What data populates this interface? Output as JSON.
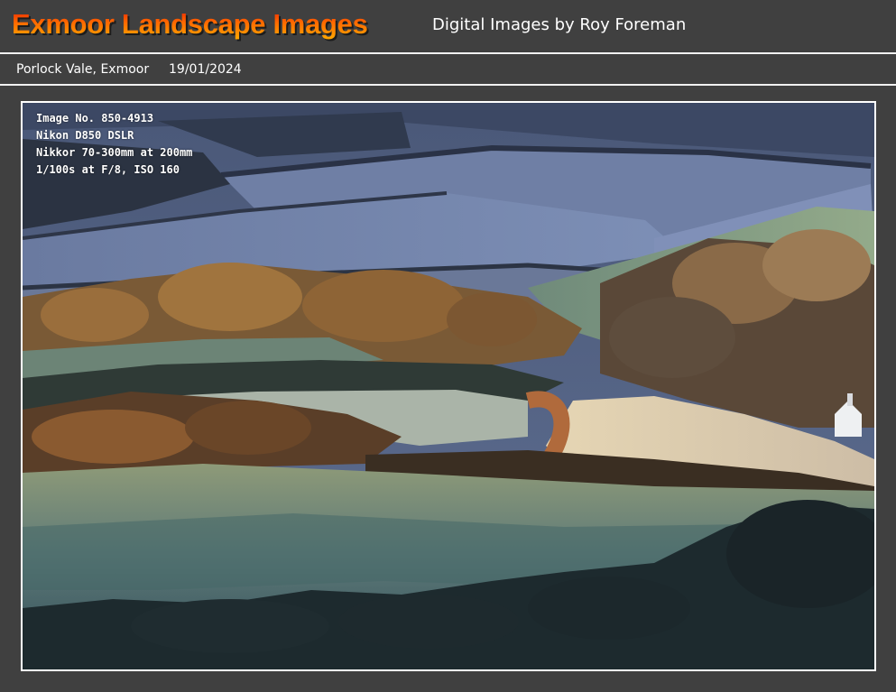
{
  "header": {
    "title": "Exmoor Landscape Images",
    "subtitle": "Digital Images by Roy Foreman"
  },
  "caption": {
    "location": "Porlock Vale, Exmoor",
    "date": "19/01/2024"
  },
  "photo": {
    "exif": {
      "image_no": "Image No. 850-4913",
      "camera": "Nikon D850 DSLR",
      "lens": "Nikkor 70-300mm at 200mm",
      "exposure": "1/100s at F/8,  ISO 160"
    }
  },
  "colors": {
    "background": "#404040",
    "divider": "#f2f2f2",
    "title_top": "#e61a00",
    "title_bottom": "#ffb000",
    "text": "#ffffff"
  }
}
